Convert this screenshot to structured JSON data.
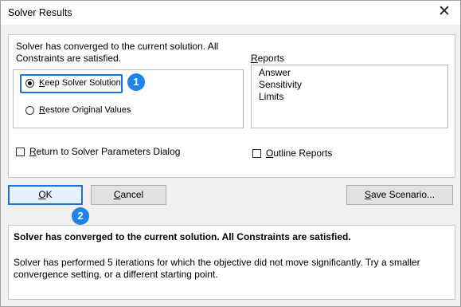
{
  "window": {
    "title": "Solver Results",
    "close_glyph": "✕"
  },
  "status": {
    "line1": "Solver has converged to the current solution.  All",
    "line2": "Constraints are satisfied."
  },
  "options": {
    "keep": {
      "first": "K",
      "rest": "eep Solver Solution"
    },
    "restore": {
      "first": "R",
      "rest": "estore Original Values"
    },
    "keep_selected": true
  },
  "reports": {
    "label_first": "R",
    "label_rest": "eports",
    "items": [
      "Answer",
      "Sensitivity",
      "Limits"
    ]
  },
  "checks": {
    "return_first": "R",
    "return_rest": "eturn to Solver Parameters Dialog",
    "outline_first": "O",
    "outline_rest": "utline Reports"
  },
  "buttons": {
    "ok_first": "O",
    "ok_rest": "K",
    "cancel_first": "C",
    "cancel_rest": "ancel",
    "save_first": "S",
    "save_rest": "ave Scenario..."
  },
  "badges": [
    "1",
    "2"
  ],
  "details": {
    "heading": "Solver has converged to the current solution.  All Constraints are satisfied.",
    "body_line1": "Solver has performed 5 iterations for which the objective did not move significantly. Try a smaller",
    "body_line2": "convergence setting, or a different starting point."
  },
  "colors": {
    "accent": "#1a73d6",
    "badge": "#1f84e8"
  }
}
